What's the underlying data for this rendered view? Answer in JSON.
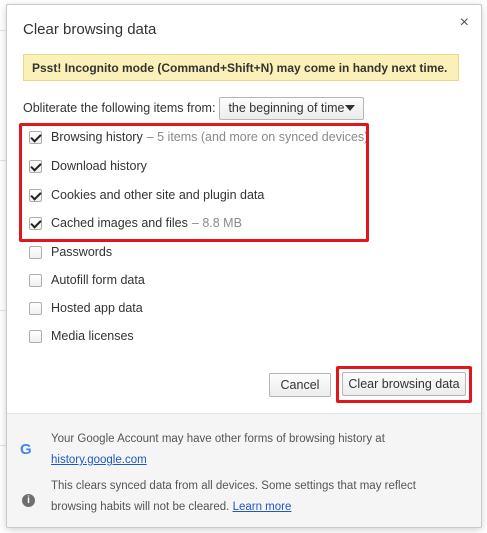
{
  "dialog": {
    "title": "Clear browsing data",
    "close_glyph": "×",
    "banner": "Psst! Incognito mode (Command+Shift+N) may come in handy next time."
  },
  "range": {
    "label": "Obliterate the following items from:",
    "selected": "the beginning of time"
  },
  "items": [
    {
      "label": "Browsing history",
      "detail": "–  5 items (and more on synced devices)",
      "checked": true
    },
    {
      "label": "Download history",
      "detail": "",
      "checked": true
    },
    {
      "label": "Cookies and other site and plugin data",
      "detail": "",
      "checked": true
    },
    {
      "label": "Cached images and files",
      "detail": "–  8.8 MB",
      "checked": true
    },
    {
      "label": "Passwords",
      "detail": "",
      "checked": false
    },
    {
      "label": "Autofill form data",
      "detail": "",
      "checked": false
    },
    {
      "label": "Hosted app data",
      "detail": "",
      "checked": false
    },
    {
      "label": "Media licenses",
      "detail": "",
      "checked": false
    }
  ],
  "buttons": {
    "cancel": "Cancel",
    "clear": "Clear browsing data"
  },
  "footer": {
    "google_line1": "Your Google Account may have other forms of browsing history at",
    "google_link": "history.google.com",
    "sync_line1": "This clears synced data from all devices. Some settings that may reflect",
    "sync_line2": "browsing habits will not be cleared.",
    "learn_more": "Learn more",
    "google_glyph": "G",
    "info_glyph": "i"
  },
  "colors": {
    "highlight": "#e0161b",
    "banner_bg": "#fcf0b9",
    "link": "#1f57c3",
    "google_blue": "#4285f4"
  }
}
